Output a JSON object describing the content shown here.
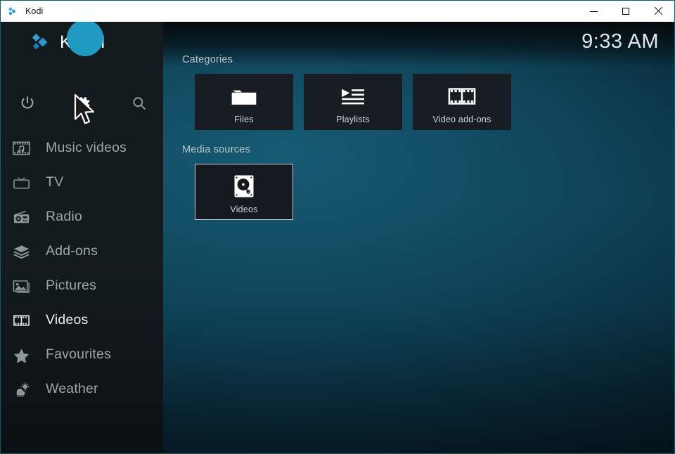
{
  "window": {
    "title": "Kodi",
    "app_icon": "kodi-logo-icon",
    "controls": {
      "minimize": "minimize-icon",
      "maximize": "maximize-icon",
      "close": "close-icon"
    }
  },
  "brand": {
    "name": "KODI",
    "logo_icon": "kodi-logo-icon",
    "accent_color": "#1f9ac0"
  },
  "clock": "9:33 AM",
  "quickbar": [
    {
      "name": "power",
      "icon": "power-icon",
      "active": false
    },
    {
      "name": "settings",
      "icon": "gear-icon",
      "active": true
    },
    {
      "name": "search",
      "icon": "search-icon",
      "active": false
    }
  ],
  "sidebar": {
    "items": [
      {
        "label": "Music videos",
        "icon": "music-video-icon",
        "active": false
      },
      {
        "label": "TV",
        "icon": "tv-icon",
        "active": false
      },
      {
        "label": "Radio",
        "icon": "radio-icon",
        "active": false
      },
      {
        "label": "Add-ons",
        "icon": "addons-box-icon",
        "active": false
      },
      {
        "label": "Pictures",
        "icon": "picture-icon",
        "active": false
      },
      {
        "label": "Videos",
        "icon": "film-strip-icon",
        "active": true
      },
      {
        "label": "Favourites",
        "icon": "star-icon",
        "active": false
      },
      {
        "label": "Weather",
        "icon": "weather-icon",
        "active": false
      }
    ]
  },
  "main": {
    "sections": {
      "categories_label": "Categories",
      "media_sources_label": "Media sources"
    },
    "categories": [
      {
        "label": "Files",
        "icon": "folder-icon",
        "focused": false
      },
      {
        "label": "Playlists",
        "icon": "playlist-icon",
        "focused": false
      },
      {
        "label": "Video add-ons",
        "icon": "film-strip-icon",
        "focused": false
      }
    ],
    "media_sources": [
      {
        "label": "Videos",
        "icon": "hard-drive-icon",
        "focused": true
      }
    ]
  },
  "cursor": {
    "icon": "arrow-cursor-icon",
    "over": "settings"
  }
}
